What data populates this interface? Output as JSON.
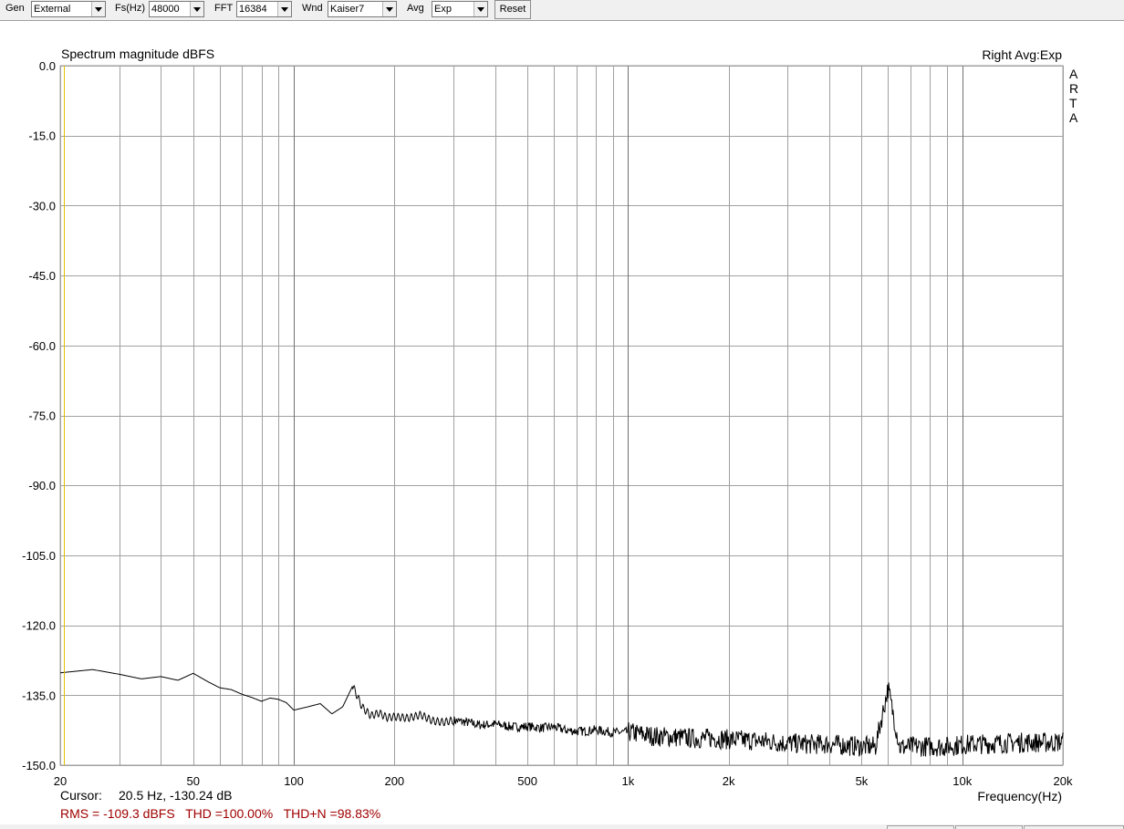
{
  "toolbar": {
    "gen_label": "Gen",
    "gen_value": "External",
    "fs_label": "Fs(Hz)",
    "fs_value": "48000",
    "fft_label": "FFT",
    "fft_value": "16384",
    "wnd_label": "Wnd",
    "wnd_value": "Kaiser7",
    "avg_label": "Avg",
    "avg_value": "Exp",
    "reset_label": "Reset"
  },
  "plot": {
    "title": "Spectrum magnitude dBFS",
    "channel_info": "Right Avg:Exp",
    "brand_letters": [
      "A",
      "R",
      "T",
      "A"
    ],
    "xlabel": "Frequency(Hz)",
    "cursor_label": "Cursor:",
    "cursor_value": "20.5 Hz, -130.24 dB",
    "stats_line": "RMS = -109.3 dBFS   THD =100.00%   THD+N =98.83%"
  },
  "colors": {
    "trace": "#000000",
    "grid": "#a0a0a0",
    "cursor": "#e0c000",
    "stats": "#a00000"
  },
  "chart_data": {
    "type": "line",
    "x_scale": "log",
    "xlim": [
      20,
      20000
    ],
    "ylim": [
      -150,
      0
    ],
    "y_ticks": [
      "0.0",
      "-15.0",
      "-30.0",
      "-45.0",
      "-60.0",
      "-75.0",
      "-90.0",
      "-105.0",
      "-120.0",
      "-135.0",
      "-150.0"
    ],
    "y_tick_values": [
      0,
      -15,
      -30,
      -45,
      -60,
      -75,
      -90,
      -105,
      -120,
      -135,
      -150
    ],
    "x_ticks": [
      "20",
      "50",
      "100",
      "200",
      "500",
      "1k",
      "2k",
      "5k",
      "10k",
      "20k"
    ],
    "x_tick_values": [
      20,
      50,
      100,
      200,
      500,
      1000,
      2000,
      5000,
      10000,
      20000
    ],
    "cursor_x": 20.5,
    "series": [
      {
        "x": [
          20,
          25,
          30,
          35,
          40,
          45,
          50,
          55,
          60,
          65,
          70,
          75,
          80,
          85,
          90,
          95,
          100,
          110,
          120,
          130,
          140,
          150,
          160,
          170,
          180,
          190,
          200,
          220,
          240,
          260,
          280,
          300,
          330,
          360,
          400,
          450,
          500,
          550,
          600,
          650,
          700,
          750,
          800,
          900,
          1000,
          1200,
          1400,
          1600,
          1800,
          2000,
          2500,
          3000,
          3500,
          4000,
          4500,
          5000,
          5500,
          6000,
          6500,
          7000,
          8000,
          9000,
          10000,
          12000,
          14000,
          16000,
          18000,
          20000
        ],
        "y": [
          -130.2,
          -129.5,
          -130.5,
          -131.5,
          -131,
          -131.8,
          -130.3,
          -132,
          -133.4,
          -133.8,
          -134.8,
          -135.5,
          -136.3,
          -135.6,
          -135.9,
          -136.6,
          -138.2,
          -137.5,
          -136.8,
          -139,
          -137.5,
          -133,
          -137.5,
          -139.4,
          -138.8,
          -139.8,
          -139.6,
          -139.9,
          -139.2,
          -140.5,
          -140.8,
          -140.4,
          -140.8,
          -141.4,
          -141.2,
          -141.8,
          -141.7,
          -142,
          -141.8,
          -142.5,
          -142.7,
          -142.7,
          -142.4,
          -143,
          -142.9,
          -143.8,
          -144,
          -144.3,
          -144.2,
          -144.5,
          -144.8,
          -145.3,
          -145.5,
          -145.5,
          -145.8,
          -146,
          -146,
          -133.5,
          -146.2,
          -146,
          -146,
          -146,
          -145.6,
          -145.4,
          -145.2,
          -145.1,
          -145.2,
          -145
        ]
      }
    ]
  }
}
